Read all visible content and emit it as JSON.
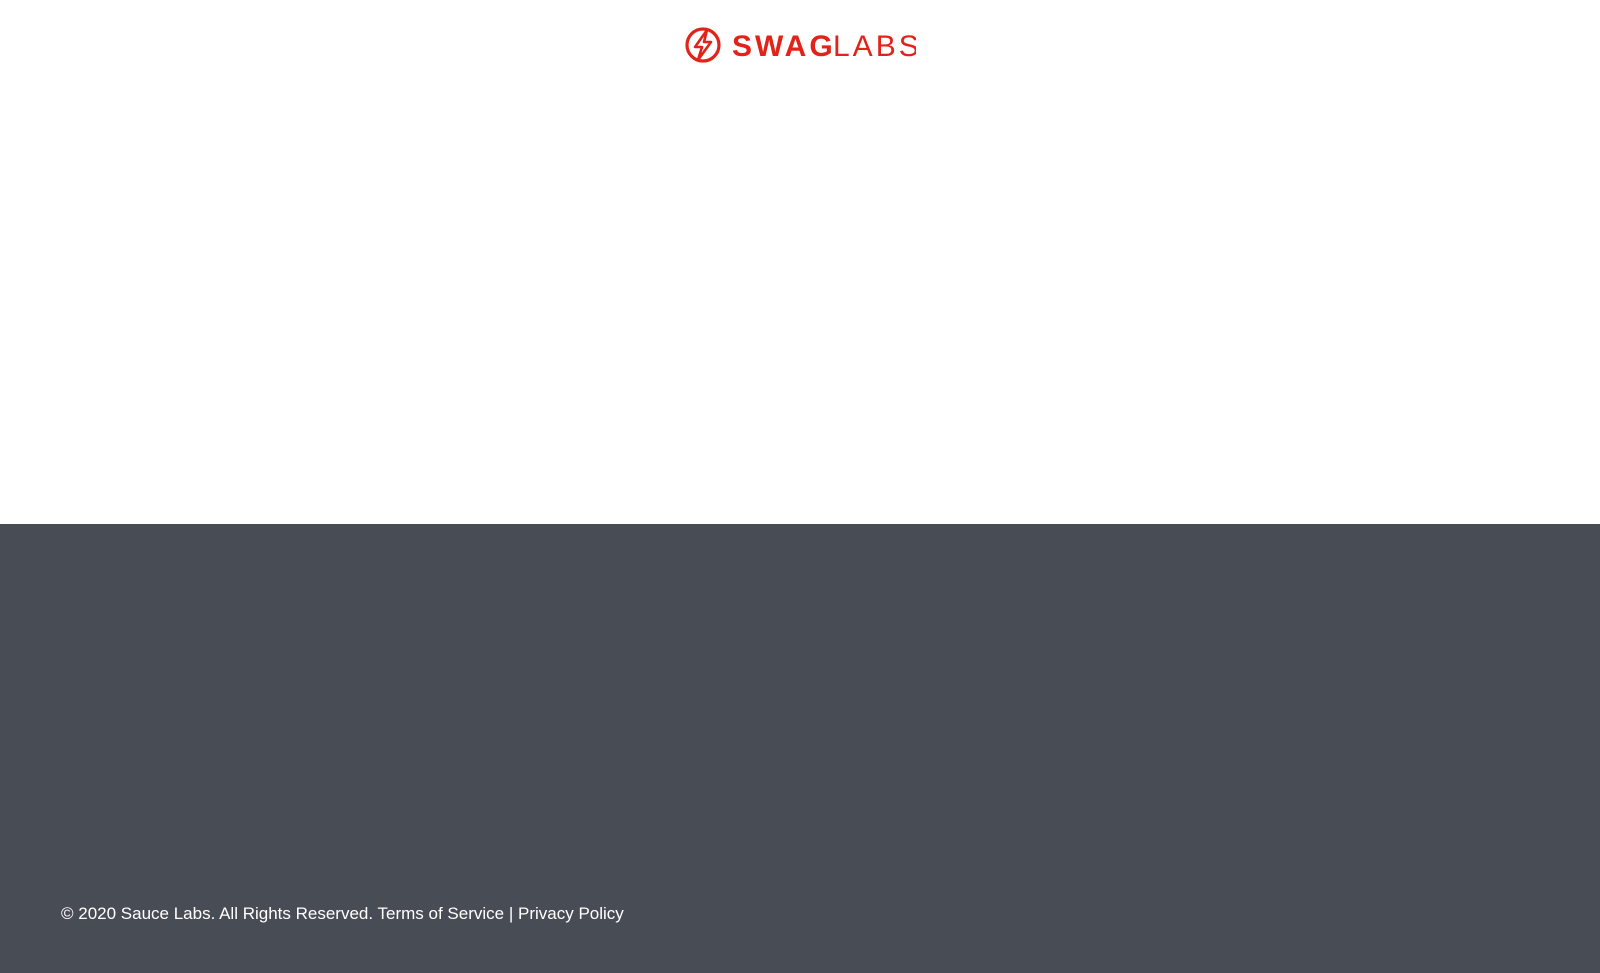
{
  "header": {
    "logo": {
      "icon": "sauce-bolt-icon",
      "text_bold": "SWAG",
      "text_light": "LABS",
      "color": "#e2231a"
    }
  },
  "footer": {
    "background": "#484c55",
    "copyright": "© 2020 Sauce Labs. All Rights Reserved.",
    "terms_label": "Terms of Service",
    "separator": "|",
    "privacy_label": "Privacy Policy"
  }
}
